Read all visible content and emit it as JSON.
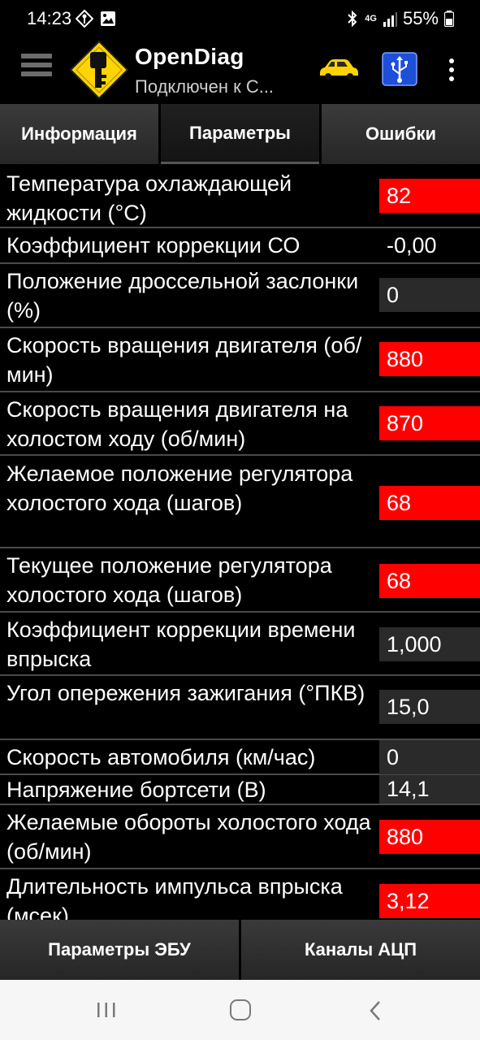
{
  "status_bar": {
    "time": "14:23",
    "battery": "55%",
    "network": "4G"
  },
  "app_bar": {
    "title": "OpenDiag",
    "subtitle": "Подключен к С..."
  },
  "tabs": [
    {
      "label": "Информация",
      "active": false
    },
    {
      "label": "Параметры",
      "active": true
    },
    {
      "label": "Ошибки",
      "active": false
    }
  ],
  "params": [
    {
      "label": "Температура охлаждающей жидкости (°C)",
      "value": "82",
      "style": "red"
    },
    {
      "label": "Коэффициент коррекции СО",
      "value": "-0,00",
      "style": "none"
    },
    {
      "label": "Положение дроссельной заслонки (%)",
      "value": "0",
      "style": "gray"
    },
    {
      "label": "Скорость вращения двигателя (об/мин)",
      "value": "880",
      "style": "red"
    },
    {
      "label": "Скорость вращения двигателя на холостом ходу (об/мин)",
      "value": "870",
      "style": "red"
    },
    {
      "label": "Желаемое положение регулятора холостого хода (шагов)",
      "value": "68",
      "style": "red"
    },
    {
      "label": "Текущее положение регулятора холостого хода (шагов)",
      "value": "68",
      "style": "red"
    },
    {
      "label": "Коэффициент коррекции времени впрыска",
      "value": "1,000",
      "style": "gray"
    },
    {
      "label": "Угол опережения зажигания (°ПКВ)",
      "value": "15,0",
      "style": "gray"
    },
    {
      "label": "Скорость автомобиля (км/час)",
      "value": "0",
      "style": "gray"
    },
    {
      "label": "Напряжение бортсети (В)",
      "value": "14,1",
      "style": "gray"
    },
    {
      "label": "Желаемые обороты холостого хода (об/мин)",
      "value": "880",
      "style": "red"
    },
    {
      "label": "Длительность импульса впрыска (мсек)",
      "value": "3,12",
      "style": "red"
    }
  ],
  "bottom_buttons": [
    {
      "label": "Параметры ЭБУ"
    },
    {
      "label": "Каналы АЦП"
    }
  ],
  "colors": {
    "background": "#000000",
    "value_red": "#ff0000",
    "value_gray": "#2a2a2a",
    "logo_yellow": "#ffd400",
    "usb_blue": "#1e4fd8"
  }
}
